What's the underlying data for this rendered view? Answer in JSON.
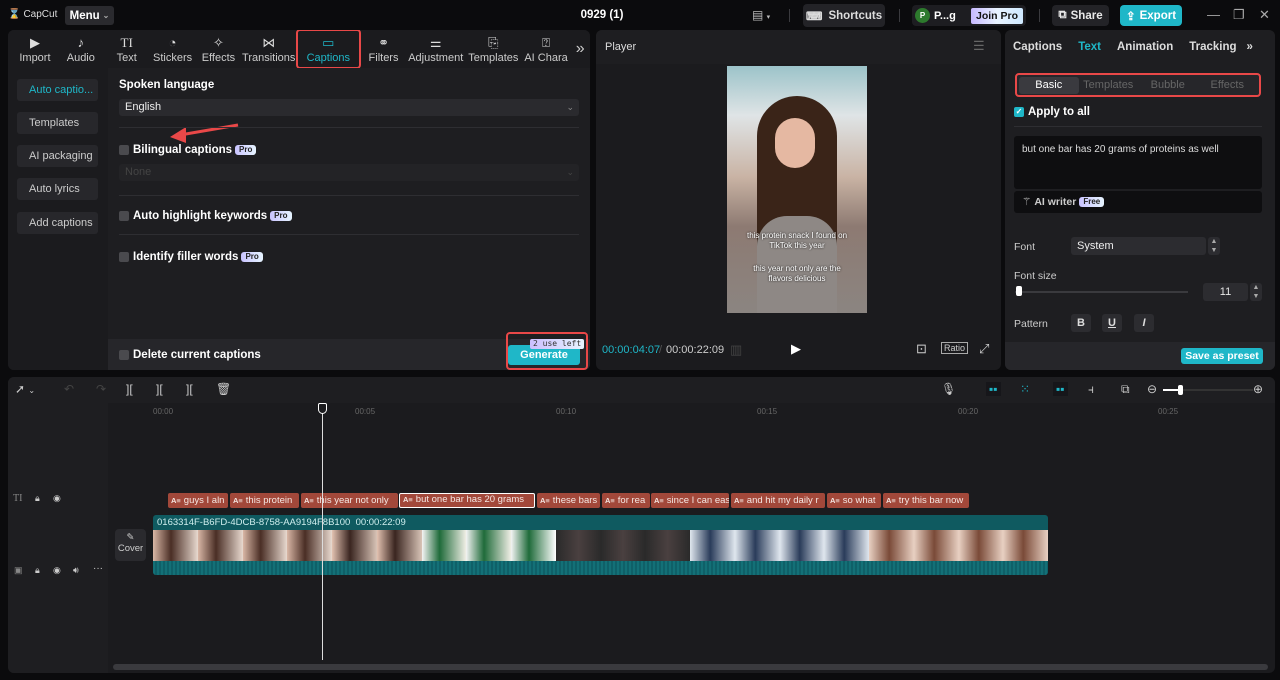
{
  "app": {
    "logo": "CapCut",
    "menu_label": "Menu",
    "project_title": "0929 (1)",
    "shortcuts_label": "Shortcuts",
    "user_initial": "P",
    "user_name": "P...g",
    "join_pro_label": "Join Pro",
    "share_label": "Share",
    "export_label": "Export",
    "accent_color": "#1fb7c8"
  },
  "toolbar_tabs": [
    {
      "label": "Import",
      "icon": "import-icon"
    },
    {
      "label": "Audio",
      "icon": "audio-icon"
    },
    {
      "label": "Text",
      "icon": "text-icon"
    },
    {
      "label": "Stickers",
      "icon": "stickers-icon"
    },
    {
      "label": "Effects",
      "icon": "effects-icon"
    },
    {
      "label": "Transitions",
      "icon": "transitions-icon"
    },
    {
      "label": "Captions",
      "icon": "captions-icon",
      "active": true
    },
    {
      "label": "Filters",
      "icon": "filters-icon"
    },
    {
      "label": "Adjustment",
      "icon": "adjustment-icon"
    },
    {
      "label": "Templates",
      "icon": "templates-icon"
    },
    {
      "label": "AI Chara",
      "icon": "ai-character-icon"
    }
  ],
  "captions_menu": [
    {
      "label": "Auto captio...",
      "active": true
    },
    {
      "label": "Templates"
    },
    {
      "label": "AI packaging"
    },
    {
      "label": "Auto lyrics"
    },
    {
      "label": "Add captions"
    }
  ],
  "auto_captions": {
    "spoken_language_label": "Spoken language",
    "spoken_language_value": "English",
    "bilingual_label": "Bilingual captions",
    "bilingual_placeholder": "None",
    "pro_badge": "Pro",
    "highlight_label": "Auto highlight keywords",
    "filler_label": "Identify filler words",
    "delete_label": "Delete current captions",
    "uses_left": "2 use left",
    "generate_label": "Generate"
  },
  "player": {
    "title": "Player",
    "caption_line1": "this protein snack I found on TikTok this year",
    "caption_line2": "this year not only are the flavors delicious",
    "current_time": "00:00:04:07",
    "total_time": "00:00:22:09",
    "ratio_label": "Ratio"
  },
  "inspector": {
    "tabs": [
      "Captions",
      "Text",
      "Animation",
      "Tracking"
    ],
    "active_tab": "Text",
    "subtabs": [
      "Basic",
      "Templates",
      "Bubble",
      "Effects"
    ],
    "active_subtab": "Basic",
    "apply_to_all_label": "Apply to all",
    "apply_to_all_checked": true,
    "caption_text": "but one bar has 20 grams of proteins as well",
    "ai_writer_label": "AI writer",
    "free_badge": "Free",
    "font_label": "Font",
    "font_value": "System",
    "font_size_label": "Font size",
    "font_size_value": "11",
    "pattern_label": "Pattern",
    "pattern_buttons": [
      "B",
      "U",
      "I"
    ],
    "save_preset_label": "Save as preset"
  },
  "timeline": {
    "ruler_ticks": [
      "00:00",
      "00:05",
      "00:10",
      "00:15",
      "00:20",
      "00:25"
    ],
    "caption_clips": [
      "guys I aln",
      "this protein",
      "this year not only",
      "but one bar has 20 grams",
      "these bars",
      "for rea",
      "since I can eas",
      "and hit my daily r",
      "so what",
      "try this bar now"
    ],
    "selected_clip_index": 3,
    "video_clip_id": "0163314F-B6FD-4DCB-8758-AA9194F8B100",
    "video_clip_duration": "00:00:22:09",
    "cover_label": "Cover"
  }
}
